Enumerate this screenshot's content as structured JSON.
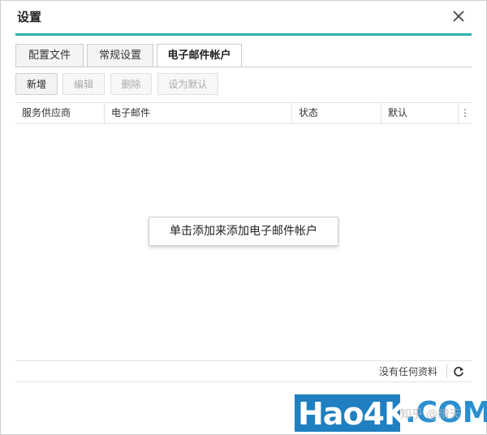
{
  "dialog": {
    "title": "设置"
  },
  "tabs": [
    {
      "label": "配置文件",
      "active": false
    },
    {
      "label": "常规设置",
      "active": false
    },
    {
      "label": "电子邮件帐户",
      "active": true
    }
  ],
  "toolbar": {
    "new_label": "新增",
    "edit_label": "编辑",
    "delete_label": "删除",
    "set_default_label": "设为默认"
  },
  "table": {
    "columns": [
      "服务供应商",
      "电子邮件",
      "状态",
      "默认"
    ],
    "column_menu_glyph": "⋮",
    "rows": []
  },
  "empty_state": {
    "button_label": "单击添加来添加电子邮件帐户"
  },
  "footer": {
    "status_text": "没有任何资料"
  },
  "watermark": {
    "brand": "Hao4K",
    "domain": ".COM",
    "overlay": "知乎 @晴天"
  },
  "colors": {
    "accent": "#2ab3b3",
    "watermark_blue": "#1f7fc0"
  },
  "icons": {
    "close": "close-icon",
    "refresh": "refresh-icon",
    "column_menu": "vertical-dots-icon"
  }
}
